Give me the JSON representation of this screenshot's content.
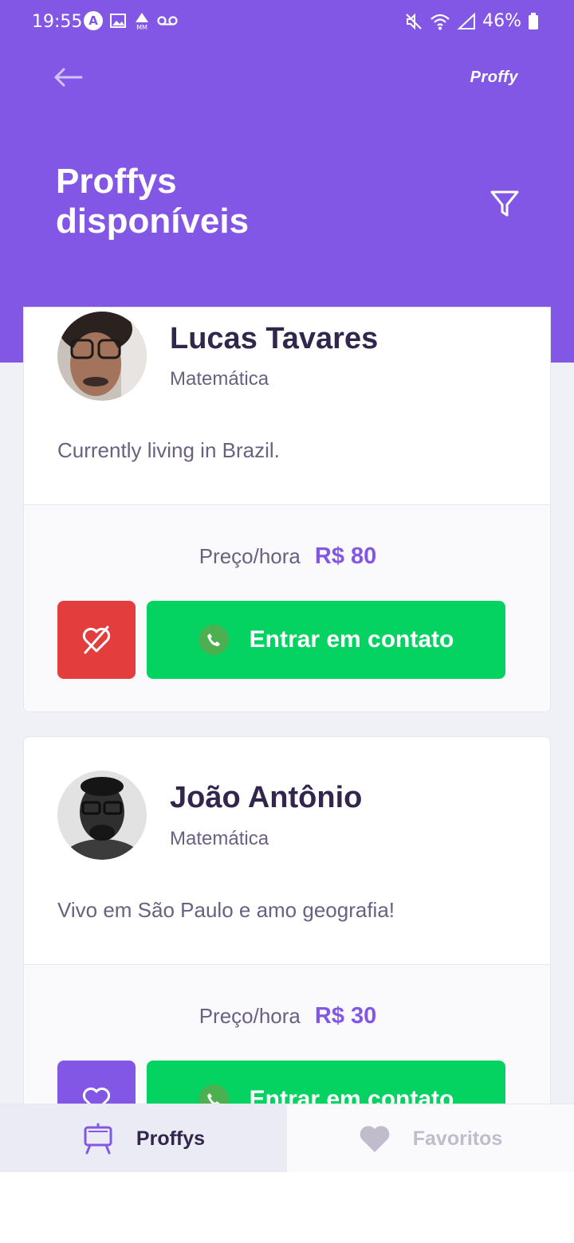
{
  "status_bar": {
    "time": "19:55",
    "battery": "46%",
    "icons": [
      "app-a-icon",
      "image-icon",
      "mm-icon",
      "voicemail-icon",
      "mute-icon",
      "wifi-icon",
      "signal-icon",
      "battery-icon"
    ]
  },
  "header": {
    "brand": "Proffy",
    "title": "Proffys disponíveis"
  },
  "teachers": [
    {
      "name": "Lucas Tavares",
      "subject": "Matemática",
      "bio": "Currently living in Brazil.",
      "price_label": "Preço/hora",
      "price": "R$ 80",
      "contact_label": "Entrar em contato",
      "favorited": true
    },
    {
      "name": "João Antônio",
      "subject": "Matemática",
      "bio": "Vivo em São Paulo e amo geografia!",
      "price_label": "Preço/hora",
      "price": "R$ 30",
      "contact_label": "Entrar em contato",
      "favorited": false
    }
  ],
  "tabs": {
    "proffys": "Proffys",
    "favoritos": "Favoritos"
  },
  "colors": {
    "primary": "#8257e5",
    "green": "#04d361",
    "unfavorite_red": "#e33d3d"
  }
}
